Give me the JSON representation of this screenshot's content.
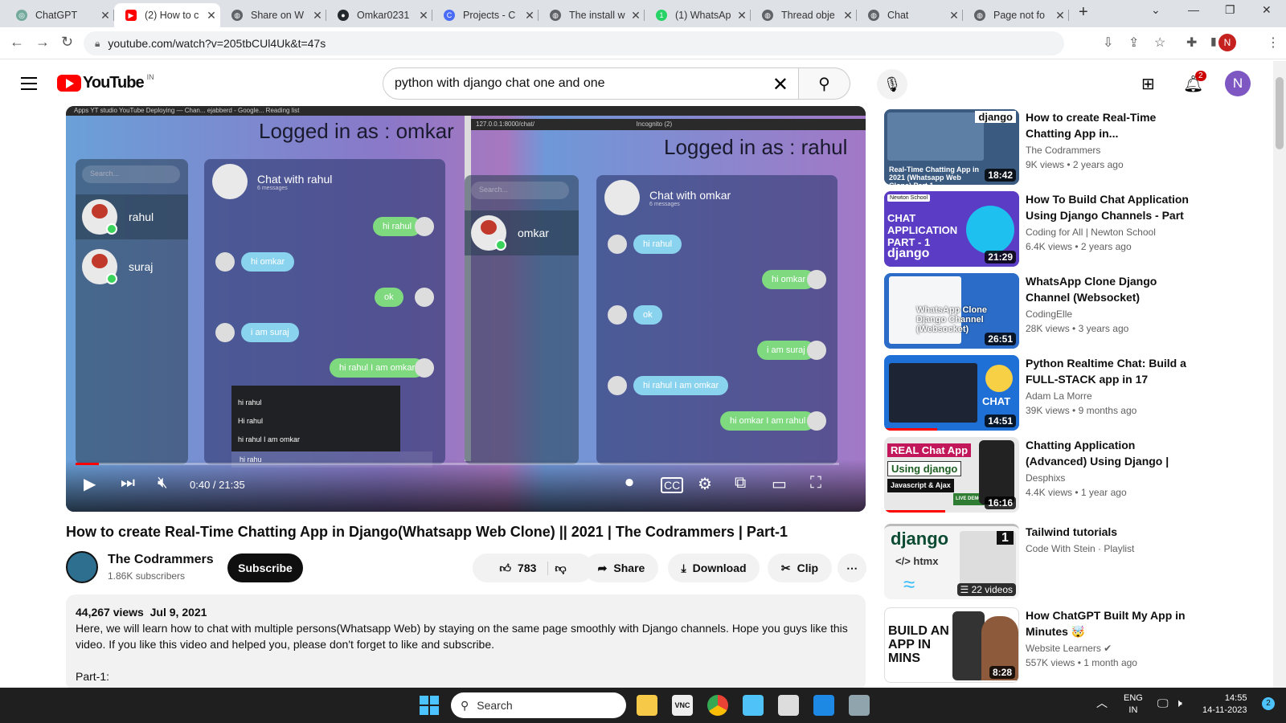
{
  "browser": {
    "tabs": [
      {
        "label": "ChatGPT",
        "icon": "chatgpt-icon",
        "color": "#74aa9c"
      },
      {
        "label": "(2) How to c",
        "icon": "youtube-icon",
        "color": "#ff0000"
      },
      {
        "label": "Share on W",
        "icon": "globe-icon",
        "color": "#5f6368"
      },
      {
        "label": "Omkar0231",
        "icon": "github-icon",
        "color": "#24292e"
      },
      {
        "label": "Projects - C",
        "icon": "projects-icon",
        "color": "#4a6cf7"
      },
      {
        "label": "The install w",
        "icon": "globe-icon",
        "color": "#5f6368"
      },
      {
        "label": "(1) WhatsAp",
        "icon": "whatsapp-icon",
        "color": "#25d366"
      },
      {
        "label": "Thread obje",
        "icon": "globe-icon",
        "color": "#5f6368"
      },
      {
        "label": "Chat",
        "icon": "globe-icon",
        "color": "#5f6368"
      },
      {
        "label": "Page not fo",
        "icon": "globe-icon",
        "color": "#5f6368"
      }
    ],
    "new_tab": "+",
    "url": "youtube.com/watch?v=205tbCUl4Uk&t=47s",
    "profile_initial": "N"
  },
  "youtube": {
    "logo_text": "YouTube",
    "region": "IN",
    "search_value": "python with django chat one and one",
    "notification_count": "2",
    "user_initial": "N"
  },
  "video_frame": {
    "left_logged": "Logged in as : omkar",
    "right_logged": "Logged in as : rahul",
    "search_placeholder": "Search...",
    "left_contacts": [
      "rahul",
      "suraj"
    ],
    "right_contacts": [
      "omkar"
    ],
    "left_chat_title": "Chat with rahul",
    "right_chat_title": "Chat with omkar",
    "messages_count": "6 messages",
    "left_messages": [
      {
        "text": "hi rahul",
        "side": "out"
      },
      {
        "text": "hi omkar",
        "side": "in"
      },
      {
        "text": "ok",
        "side": "out"
      },
      {
        "text": "i am suraj",
        "side": "in"
      },
      {
        "text": "hi rahul I am omkar",
        "side": "out"
      }
    ],
    "right_messages": [
      {
        "text": "hi rahul",
        "side": "in"
      },
      {
        "text": "hi omkar",
        "side": "out"
      },
      {
        "text": "ok",
        "side": "in"
      },
      {
        "text": "i am suraj",
        "side": "out"
      },
      {
        "text": "hi rahul I am omkar",
        "side": "in"
      },
      {
        "text": "hi omkar I am rahul",
        "side": "out"
      }
    ],
    "suggestions": [
      "hi rahul",
      "Hi rahul",
      "hi rahul I am omkar"
    ],
    "typed_input": "hi rahu",
    "bookmarks": "Apps   YT studio   YouTube   Deploying — Chan...   ejabberd - Google...   Reading list",
    "inner_url": "127.0.0.1:8000/chat/",
    "incognito": "Incognito (2)"
  },
  "player": {
    "time": "0:40 / 21:35",
    "progress_fraction": 0.031
  },
  "video": {
    "title": "How to create Real-Time Chatting App in Django(Whatsapp Web Clone) || 2021 | The Codrammers | Part-1",
    "channel": "The Codrammers",
    "subscribers": "1.86K subscribers",
    "subscribe_label": "Subscribe",
    "likes": "783",
    "share_label": "Share",
    "download_label": "Download",
    "clip_label": "Clip",
    "views": "44,267 views",
    "date": "Jul 9, 2021",
    "description": "Here, we will learn how to chat with multiple persons(Whatsapp Web) by staying on the same page smoothly with Django channels. Hope you guys like this video. If you like this video and helped you, please don't forget to like and subscribe.",
    "part_label": "Part-1:"
  },
  "recommendations": [
    {
      "title": "How to create Real-Time Chatting App in...",
      "channel": "The Codrammers",
      "views": "9K views",
      "age": "2 years ago",
      "duration": "18:42",
      "thumb_text": "Real-Time Chatting App in 2021 (Whatsapp Web Clone) Part 1",
      "thumb_tag": "django",
      "thumb_color": "#3a5a80"
    },
    {
      "title": "How To Build Chat Application Using Django Channels - Part ...",
      "channel": "Coding for All | Newton School",
      "views": "6.4K views",
      "age": "2 years ago",
      "duration": "21:29",
      "thumb_text": "CHAT APPLICATION PART - 1",
      "thumb_tag": "django",
      "thumb_badge": "Newton School",
      "thumb_color": "#5b3cc4"
    },
    {
      "title": "WhatsApp Clone Django Channel (Websocket)",
      "channel": "CodingElle",
      "views": "28K views",
      "age": "3 years ago",
      "duration": "26:51",
      "thumb_text": "WhatsApp Clone Django Channel (Websocket)",
      "thumb_color": "#2a6cc8"
    },
    {
      "title": "Python Realtime Chat: Build a FULL-STACK app in 17 Minute...",
      "channel": "Adam La Morre",
      "views": "39K views",
      "age": "9 months ago",
      "duration": "14:51",
      "thumb_text": "CHAT",
      "thumb_color": "#1e6fd6"
    },
    {
      "title": "Chatting Application (Advanced) Using Django | On...",
      "channel": "Desphixs",
      "views": "4.4K views",
      "age": "1 year ago",
      "duration": "16:16",
      "thumb_text": "REAL Chat App",
      "thumb_sub": "Using django",
      "thumb_sub2": "Javascript & Ajax",
      "thumb_badge": "LIVE DEMO",
      "thumb_color": "#e8e8e8"
    },
    {
      "title": "Tailwind tutorials",
      "channel": "Code With Stein · Playlist",
      "views": "",
      "age": "",
      "duration": "22 videos",
      "thumb_text": "django",
      "thumb_sub": "</> htmx",
      "thumb_badge": "1",
      "thumb_color": "#f4f4f4"
    },
    {
      "title": "How ChatGPT Built My App in Minutes 🤯",
      "channel": "Website Learners",
      "verified": "✔",
      "views": "557K views",
      "age": "1 month ago",
      "duration": "8:28",
      "thumb_text": "BUILD AN APP IN MINS",
      "thumb_color": "#ffffff"
    }
  ],
  "taskbar": {
    "search_label": "Search",
    "lang": "ENG",
    "region": "IN",
    "time": "14:55",
    "date": "14-11-2023",
    "notif": "2"
  }
}
